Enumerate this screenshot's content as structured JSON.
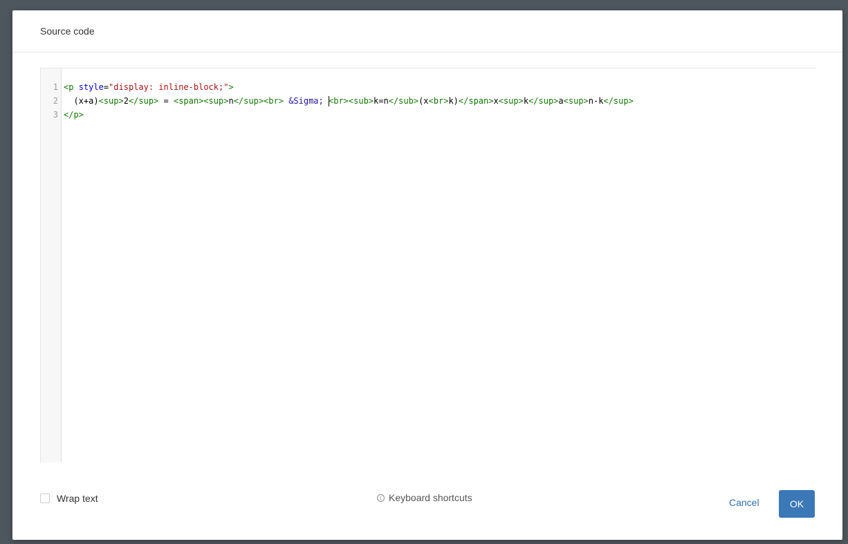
{
  "dialog": {
    "title": "Source code"
  },
  "editor": {
    "line_numbers": [
      "1",
      "2",
      "3"
    ],
    "lines": [
      [
        {
          "t": "tag",
          "v": "<p"
        },
        {
          "t": "text",
          "v": " "
        },
        {
          "t": "attr",
          "v": "style"
        },
        {
          "t": "text",
          "v": "="
        },
        {
          "t": "str",
          "v": "\"display: inline-block;\""
        },
        {
          "t": "tag",
          "v": ">"
        }
      ],
      [
        {
          "t": "text",
          "v": "  (x+a)"
        },
        {
          "t": "tag",
          "v": "<sup>"
        },
        {
          "t": "text",
          "v": "2"
        },
        {
          "t": "tag",
          "v": "</sup>"
        },
        {
          "t": "text",
          "v": " = "
        },
        {
          "t": "tag",
          "v": "<span><sup>"
        },
        {
          "t": "text",
          "v": "n"
        },
        {
          "t": "tag",
          "v": "</sup><br>"
        },
        {
          "t": "text",
          "v": " "
        },
        {
          "t": "ent",
          "v": "&Sigma;"
        },
        {
          "t": "text",
          "v": " "
        },
        {
          "t": "cursor",
          "v": ""
        },
        {
          "t": "tag",
          "v": "<br><sub>"
        },
        {
          "t": "text",
          "v": "k=n"
        },
        {
          "t": "tag",
          "v": "</sub>"
        },
        {
          "t": "text",
          "v": "(x"
        },
        {
          "t": "tag",
          "v": "<br>"
        },
        {
          "t": "text",
          "v": "k)"
        },
        {
          "t": "tag",
          "v": "</span>"
        },
        {
          "t": "text",
          "v": "x"
        },
        {
          "t": "tag",
          "v": "<sup>"
        },
        {
          "t": "text",
          "v": "k"
        },
        {
          "t": "tag",
          "v": "</sup>"
        },
        {
          "t": "text",
          "v": "a"
        },
        {
          "t": "tag",
          "v": "<sup>"
        },
        {
          "t": "text",
          "v": "n-k"
        },
        {
          "t": "tag",
          "v": "</sup>"
        }
      ],
      [
        {
          "t": "tag",
          "v": "</p>"
        }
      ]
    ]
  },
  "footer": {
    "wrap_text_label": "Wrap text",
    "wrap_text_checked": false,
    "shortcuts_label": "Keyboard shortcuts",
    "info_icon_glyph": "i",
    "cancel_label": "Cancel",
    "ok_label": "OK"
  },
  "colors": {
    "tag": "#117700",
    "attr": "#0000cc",
    "string": "#aa1111",
    "entity": "#221199",
    "primary_button": "#3b78b7",
    "link": "#2e6eb0"
  }
}
